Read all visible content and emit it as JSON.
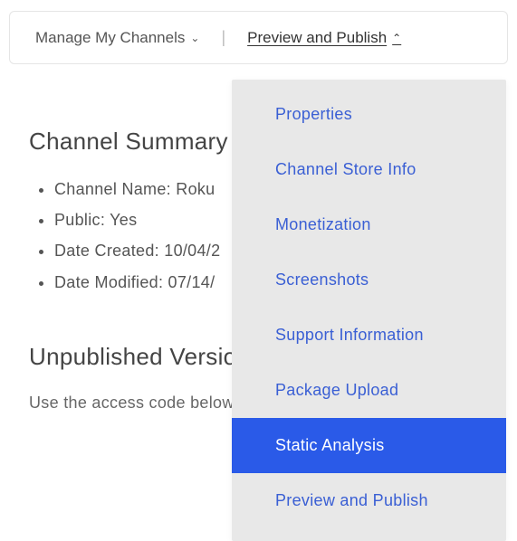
{
  "topbar": {
    "manage_label": "Manage My Channels",
    "preview_label": "Preview and Publish"
  },
  "summary": {
    "title": "Channel Summary",
    "items": [
      "Channel Name: Roku",
      "Public: Yes",
      "Date Created: 10/04/2",
      "Date Modified: 07/14/"
    ]
  },
  "unpublished": {
    "title": "Unpublished Versio",
    "description": "Use the access code below publishing."
  },
  "dropdown": {
    "items": [
      {
        "label": "Properties",
        "active": false
      },
      {
        "label": "Channel Store Info",
        "active": false
      },
      {
        "label": "Monetization",
        "active": false
      },
      {
        "label": "Screenshots",
        "active": false
      },
      {
        "label": "Support Information",
        "active": false
      },
      {
        "label": "Package Upload",
        "active": false
      },
      {
        "label": "Static Analysis",
        "active": true
      },
      {
        "label": "Preview and Publish",
        "active": false
      }
    ]
  }
}
